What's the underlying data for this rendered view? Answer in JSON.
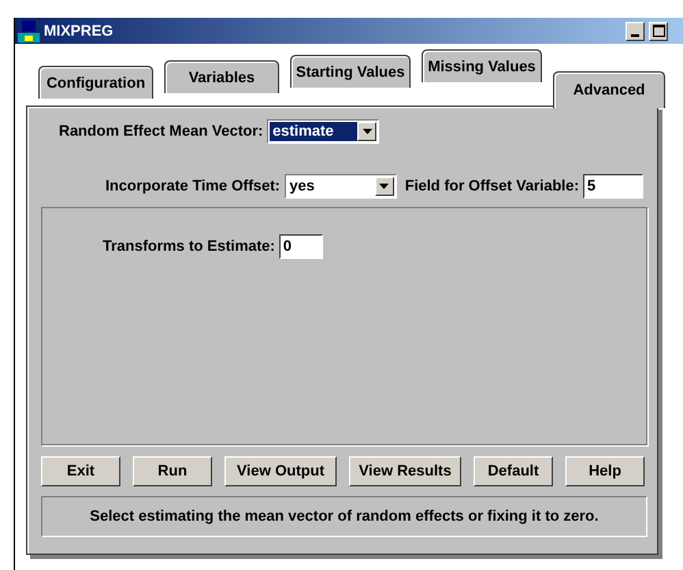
{
  "window": {
    "title": "MIXPREG"
  },
  "tabs": [
    {
      "label": "Configuration",
      "selected": false
    },
    {
      "label": "Variables",
      "selected": false
    },
    {
      "label": "Starting Values",
      "selected": false
    },
    {
      "label": "Missing Values",
      "selected": false
    },
    {
      "label": "Advanced",
      "selected": true
    }
  ],
  "random_effect_mean_vector": {
    "label": "Random Effect Mean Vector:",
    "value": "estimate",
    "focused": true
  },
  "incorporate_time_offset": {
    "label": "Incorporate Time Offset:",
    "value": "yes",
    "focused": false
  },
  "field_for_offset_variable": {
    "label": "Field for Offset Variable:",
    "value": "5"
  },
  "transforms_to_estimate": {
    "label": "Transforms to Estimate:",
    "value": "0"
  },
  "buttons": [
    "Exit",
    "Run",
    "View Output",
    "View Results",
    "Default",
    "Help"
  ],
  "status_bar": "Select estimating the mean vector of random effects or fixing it to zero."
}
